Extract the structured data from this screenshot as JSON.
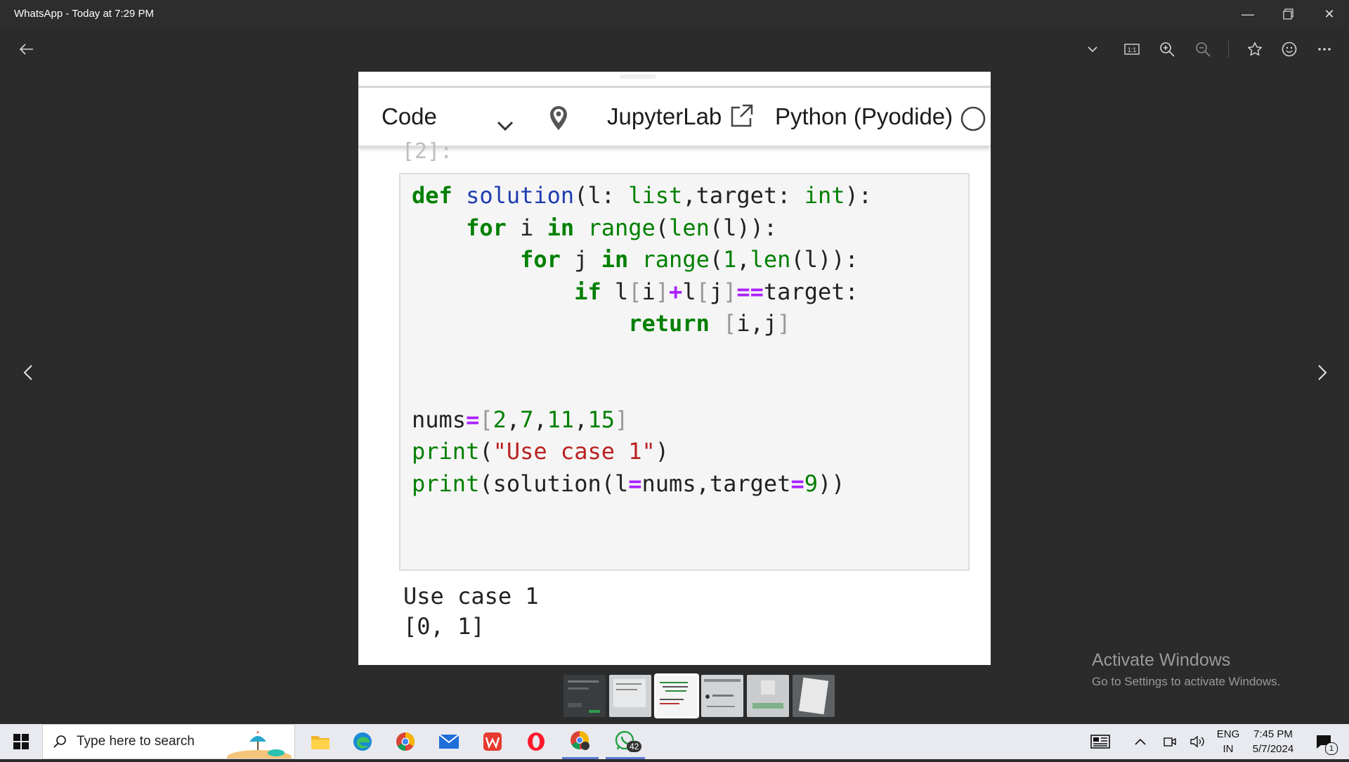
{
  "window": {
    "title": "WhatsApp - Today at 7:29 PM"
  },
  "viewer": {
    "back_label": "←",
    "prev_label": "‹",
    "next_label": "›"
  },
  "notebook": {
    "toolbar": {
      "cell_type": "Code",
      "jupyterlab_label": "JupyterLab",
      "kernel_label": "Python (Pyodide)"
    },
    "cell_prompt": "[2]:",
    "output_lines": [
      "Use case 1",
      "[0, 1]"
    ]
  },
  "watermark": {
    "title": "Activate Windows",
    "subtitle": "Go to Settings to activate Windows."
  },
  "thumbnails": [
    {
      "tone": "dark"
    },
    {
      "tone": "light"
    },
    {
      "tone": "code",
      "active": true
    },
    {
      "tone": "light"
    },
    {
      "tone": "light"
    },
    {
      "tone": "paper"
    }
  ],
  "taskbar": {
    "search_placeholder": "Type here to search",
    "whatsapp_badge": "42",
    "language": "ENG",
    "region": "IN",
    "time": "7:45 PM",
    "date": "5/7/2024",
    "notification_count": "1"
  }
}
